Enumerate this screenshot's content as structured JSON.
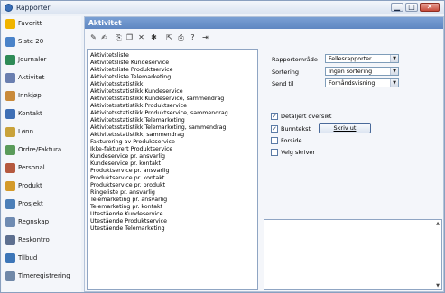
{
  "window": {
    "title": "Rapporter",
    "minimize_glyph": "▁",
    "maximize_glyph": "□",
    "close_glyph": "✕"
  },
  "sidebar": {
    "items": [
      {
        "label": "Favoritt",
        "icon": "star-icon",
        "color": "#f0b400"
      },
      {
        "label": "Siste 20",
        "icon": "clock-icon",
        "color": "#4a83c9"
      },
      {
        "label": "Journaler",
        "icon": "book-icon",
        "color": "#2e8b57"
      },
      {
        "label": "Aktivitet",
        "icon": "activity-icon",
        "color": "#6a7fb0"
      },
      {
        "label": "Innkjøp",
        "icon": "purchase-icon",
        "color": "#c98a3a"
      },
      {
        "label": "Kontakt",
        "icon": "contact-icon",
        "color": "#3f6fb5"
      },
      {
        "label": "Lønn",
        "icon": "salary-icon",
        "color": "#c9a23a"
      },
      {
        "label": "Ordre/Faktura",
        "icon": "invoice-icon",
        "color": "#5a9b5a"
      },
      {
        "label": "Personal",
        "icon": "person-icon",
        "color": "#b5593f"
      },
      {
        "label": "Produkt",
        "icon": "product-icon",
        "color": "#d49a2a"
      },
      {
        "label": "Prosjekt",
        "icon": "project-icon",
        "color": "#4c7fb8"
      },
      {
        "label": "Regnskap",
        "icon": "accounting-icon",
        "color": "#6f8bb2"
      },
      {
        "label": "Reskontro",
        "icon": "ledger-icon",
        "color": "#5d6f8f"
      },
      {
        "label": "Tilbud",
        "icon": "offer-icon",
        "color": "#3d76b8"
      },
      {
        "label": "Timeregistrering",
        "icon": "timesheet-icon",
        "color": "#7088a8"
      }
    ]
  },
  "panel": {
    "title": "Aktivitet"
  },
  "toolbar": {
    "buttons": [
      {
        "icon": "edit-icon",
        "glyph": "✎"
      },
      {
        "icon": "edit-list-icon",
        "glyph": "✍"
      },
      {
        "icon": "new-report-icon",
        "glyph": "⎘"
      },
      {
        "icon": "copy-icon",
        "glyph": "❐"
      },
      {
        "icon": "delete-icon",
        "glyph": "✕"
      },
      {
        "icon": "tools-icon",
        "glyph": "✱"
      },
      {
        "icon": "export-icon",
        "glyph": "⇱"
      },
      {
        "icon": "print-icon",
        "glyph": "⎙"
      },
      {
        "icon": "help-icon",
        "glyph": "?"
      },
      {
        "icon": "exit-icon",
        "glyph": "⇥"
      }
    ]
  },
  "reports": [
    "Aktivitetsliste",
    "Aktivitetsliste Kundeservice",
    "Aktivitetsliste Produktservice",
    "Aktivitetsliste Telemarketing",
    "Aktivitetsstatistikk",
    "Aktivitetsstatistikk Kundeservice",
    "Aktivitetsstatistikk Kundeservice, sammendrag",
    "Aktivitetsstatistikk Produktservice",
    "Aktivitetsstatistikk Produktservice, sammendrag",
    "Aktivitetsstatistikk Telemarketing",
    "Aktivitetsstatistikk Telemarketing, sammendrag",
    "Aktivitetsstatistikk, sammendrag",
    "Fakturering av Produktservice",
    "Ikke-fakturert Produktservice",
    "Kundeservice pr. ansvarlig",
    "Kundeservice pr. kontakt",
    "Produktservice pr. ansvarlig",
    "Produktservice pr. kontakt",
    "Produktservice pr. produkt",
    "Ringeliste pr. ansvarlig",
    "Telemarketing pr. ansvarlig",
    "Telemarketing pr. kontakt",
    "Utestående Kundeservice",
    "Utestående Produktservice",
    "Utestående Telemarketing"
  ],
  "form": {
    "rapportomrade_label": "Rapportområde",
    "rapportomrade_value": "Fellesrapporter",
    "sortering_label": "Sortering",
    "sortering_value": "Ingen sortering",
    "send_til_label": "Send til",
    "send_til_value": "Forhåndsvisning",
    "print_button": "Skriv ut",
    "options": [
      {
        "label": "Detaljert oversikt",
        "checked": true
      },
      {
        "label": "Bunntekst",
        "checked": true
      },
      {
        "label": "Forside",
        "checked": false
      },
      {
        "label": "Velg skriver",
        "checked": false
      }
    ]
  },
  "colors": {
    "accent": "#5f87c2",
    "window_bg": "#eef2f8"
  }
}
